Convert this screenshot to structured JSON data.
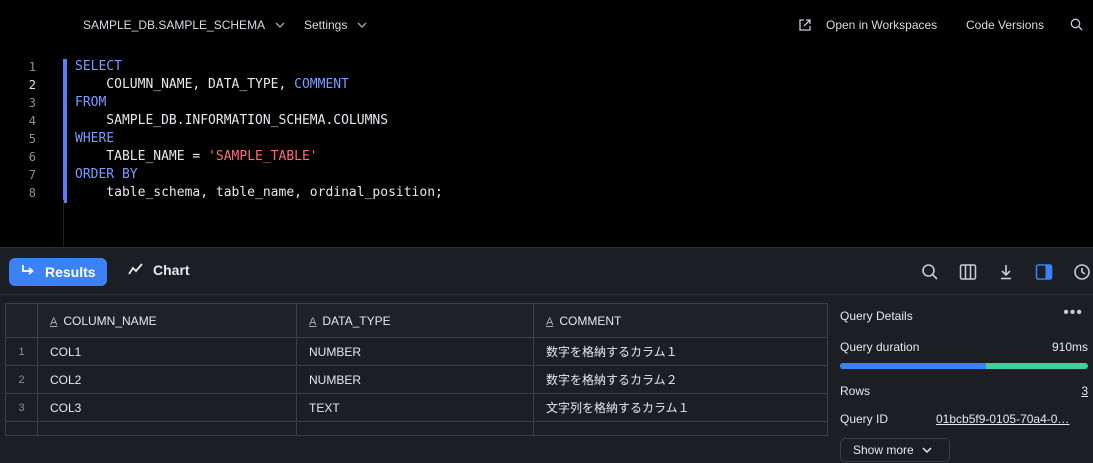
{
  "topbar": {
    "context": "SAMPLE_DB.SAMPLE_SCHEMA",
    "settings": "Settings",
    "open_workspaces": "Open in Workspaces",
    "code_versions": "Code Versions"
  },
  "editor": {
    "line_numbers": [
      "1",
      "2",
      "3",
      "4",
      "5",
      "6",
      "7",
      "8"
    ],
    "lines": {
      "l1": "SELECT",
      "l2a": "    COLUMN_NAME, DATA_TYPE, ",
      "l2b": "COMMENT",
      "l3": "FROM",
      "l4": "    SAMPLE_DB.INFORMATION_SCHEMA.COLUMNS",
      "l5": "WHERE",
      "l6a": "    TABLE_NAME = ",
      "l6b": "'SAMPLE_TABLE'",
      "l7": "ORDER BY",
      "l8": "    table_schema, table_name, ordinal_position;"
    }
  },
  "results_bar": {
    "results_label": "Results",
    "chart_label": "Chart"
  },
  "grid": {
    "type_glyph": "A",
    "columns": [
      "COLUMN_NAME",
      "DATA_TYPE",
      "COMMENT"
    ],
    "rows": [
      {
        "idx": "1",
        "column_name": "COL1",
        "data_type": "NUMBER",
        "comment": "数字を格納するカラム１"
      },
      {
        "idx": "2",
        "column_name": "COL2",
        "data_type": "NUMBER",
        "comment": "数字を格納するカラム２"
      },
      {
        "idx": "3",
        "column_name": "COL3",
        "data_type": "TEXT",
        "comment": "文字列を格納するカラム１"
      }
    ]
  },
  "query_details": {
    "title": "Query Details",
    "more": "•••",
    "duration_label": "Query duration",
    "duration_value": "910ms",
    "duration_fraction": 0.59,
    "rows_label": "Rows",
    "rows_value": "3",
    "query_id_label": "Query ID",
    "query_id_value": "01bcb5f9-0105-70a4-0…",
    "show_more": "Show more"
  },
  "colors": {
    "accent": "#3b82f6",
    "keyword": "#7c9cff",
    "string": "#ff6b7a",
    "bar_secondary": "#3ecf9f"
  }
}
